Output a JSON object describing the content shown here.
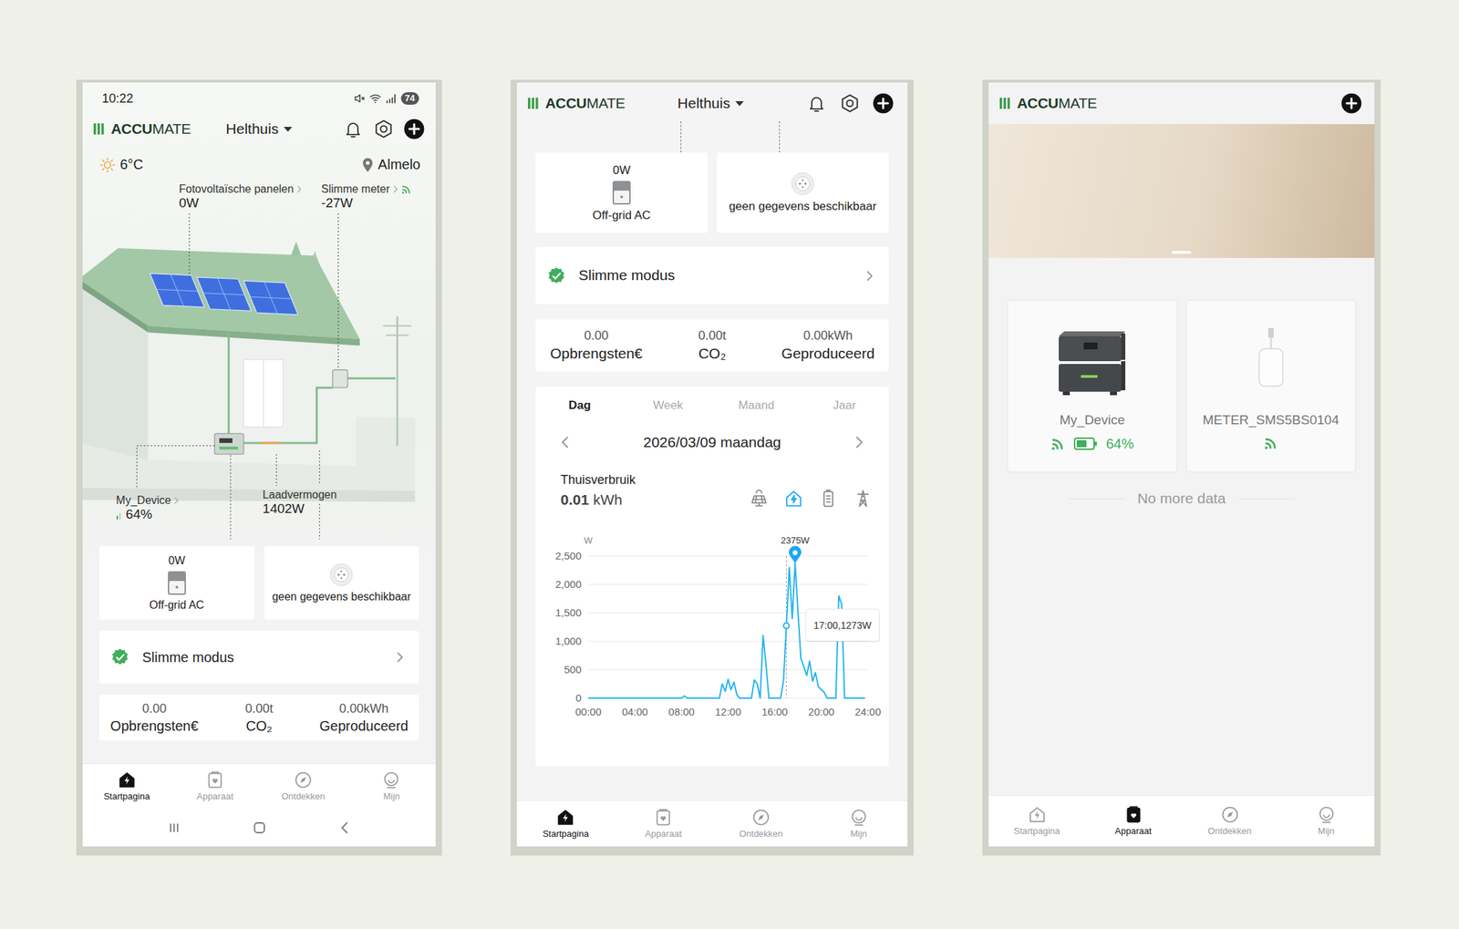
{
  "home_screen": {
    "status_bar": {
      "time": "10:22",
      "battery": "74"
    },
    "header": {
      "logo_bold": "ACCU",
      "logo_light": "MATE",
      "home": "Helthuis"
    },
    "weather": {
      "temperature": "6°C",
      "location": "Almelo"
    },
    "diagram": {
      "solar": {
        "label": "Fotovoltaïsche panelen",
        "value": "0W"
      },
      "meter": {
        "label": "Slimme meter",
        "value": "-27W",
        "connected": true
      },
      "device": {
        "label": "My_Device",
        "value": "64%"
      },
      "charge": {
        "label": "Laadvermogen",
        "value": "1402W"
      }
    },
    "outputs": [
      {
        "kind": "offgrid",
        "value": "0W",
        "label": "Off-grid AC"
      },
      {
        "kind": "socket",
        "label": "geen gegevens beschikbaar"
      }
    ],
    "smart_mode": "Slimme modus",
    "stats": [
      {
        "value": "0.00",
        "label": "Opbrengsten€"
      },
      {
        "value": "0.00t",
        "label": "CO₂"
      },
      {
        "value": "0.00kWh",
        "label": "Geproduceerd"
      }
    ],
    "nav": [
      {
        "label": "Startpagina",
        "selected": true
      },
      {
        "label": "Apparaat",
        "selected": false
      },
      {
        "label": "Ontdekken",
        "selected": false
      },
      {
        "label": "Mijn",
        "selected": false
      }
    ]
  },
  "scrolled_screen": {
    "header": {
      "logo_bold": "ACCU",
      "logo_light": "MATE",
      "home": "Helthuis"
    },
    "outputs": [
      {
        "kind": "offgrid",
        "value": "0W",
        "label": "Off-grid AC"
      },
      {
        "kind": "socket",
        "label": "geen gegevens beschikbaar"
      }
    ],
    "smart_mode": "Slimme modus",
    "stats": [
      {
        "value": "0.00",
        "label": "Opbrengsten€"
      },
      {
        "value": "0.00t",
        "label": "CO₂"
      },
      {
        "value": "0.00kWh",
        "label": "Geproduceerd"
      }
    ],
    "chart": {
      "tabs": [
        {
          "label": "Dag",
          "selected": true
        },
        {
          "label": "Week",
          "selected": false
        },
        {
          "label": "Maand",
          "selected": false
        },
        {
          "label": "Jaar",
          "selected": false
        }
      ],
      "date": "2026/03/09 maandag",
      "metric": {
        "label": "Thuisverbruik",
        "value": "0.01",
        "unit": "kWh"
      },
      "sources": [
        {
          "selected": false
        },
        {
          "selected": true
        },
        {
          "selected": false
        },
        {
          "selected": false
        }
      ],
      "unit": "W",
      "y_ticks": [
        "2,500",
        "2,000",
        "1,500",
        "1,000",
        "500",
        "0"
      ],
      "x_ticks": [
        "00:00",
        "04:00",
        "08:00",
        "12:00",
        "16:00",
        "20:00",
        "24:00"
      ],
      "series": [
        0,
        0,
        0,
        0,
        0,
        0,
        0,
        0,
        0,
        0,
        0,
        0,
        0,
        0,
        0,
        0,
        0,
        0,
        0,
        0,
        0,
        0,
        0,
        0,
        0,
        0,
        0,
        0,
        0,
        0,
        0,
        0,
        0,
        40,
        0,
        0,
        0,
        0,
        0,
        0,
        0,
        0,
        0,
        0,
        0,
        0,
        250,
        120,
        330,
        150,
        280,
        60,
        0,
        0,
        0,
        0,
        0,
        320,
        250,
        0,
        1100,
        600,
        0,
        0,
        0,
        0,
        0,
        300,
        1273,
        2300,
        1400,
        2375,
        1500,
        700,
        550,
        400,
        650,
        300,
        450,
        200,
        150,
        100,
        0,
        0,
        0,
        0,
        1800,
        1650,
        0,
        0,
        0,
        0,
        0,
        0,
        0,
        0
      ],
      "pin": {
        "index": 71,
        "label": "2375W"
      },
      "tooltip": {
        "index": 68,
        "text": "17:00,1273W"
      }
    },
    "nav": [
      {
        "label": "Startpagina",
        "selected": true
      },
      {
        "label": "Apparaat",
        "selected": false
      },
      {
        "label": "Ontdekken",
        "selected": false
      },
      {
        "label": "Mijn",
        "selected": false
      }
    ]
  },
  "devices_screen": {
    "header": {
      "logo_bold": "ACCU",
      "logo_light": "MATE"
    },
    "devices": [
      {
        "kind": "battery",
        "name": "My_Device",
        "connected": true,
        "level": 0.64,
        "reading": "64%"
      },
      {
        "kind": "meter",
        "name": "METER_SMS5BS0104",
        "connected": true
      }
    ],
    "footer": "No more data",
    "nav": [
      {
        "label": "Startpagina",
        "selected": false
      },
      {
        "label": "Apparaat",
        "selected": true
      },
      {
        "label": "Ontdekken",
        "selected": false
      },
      {
        "label": "Mijn",
        "selected": false
      }
    ]
  }
}
